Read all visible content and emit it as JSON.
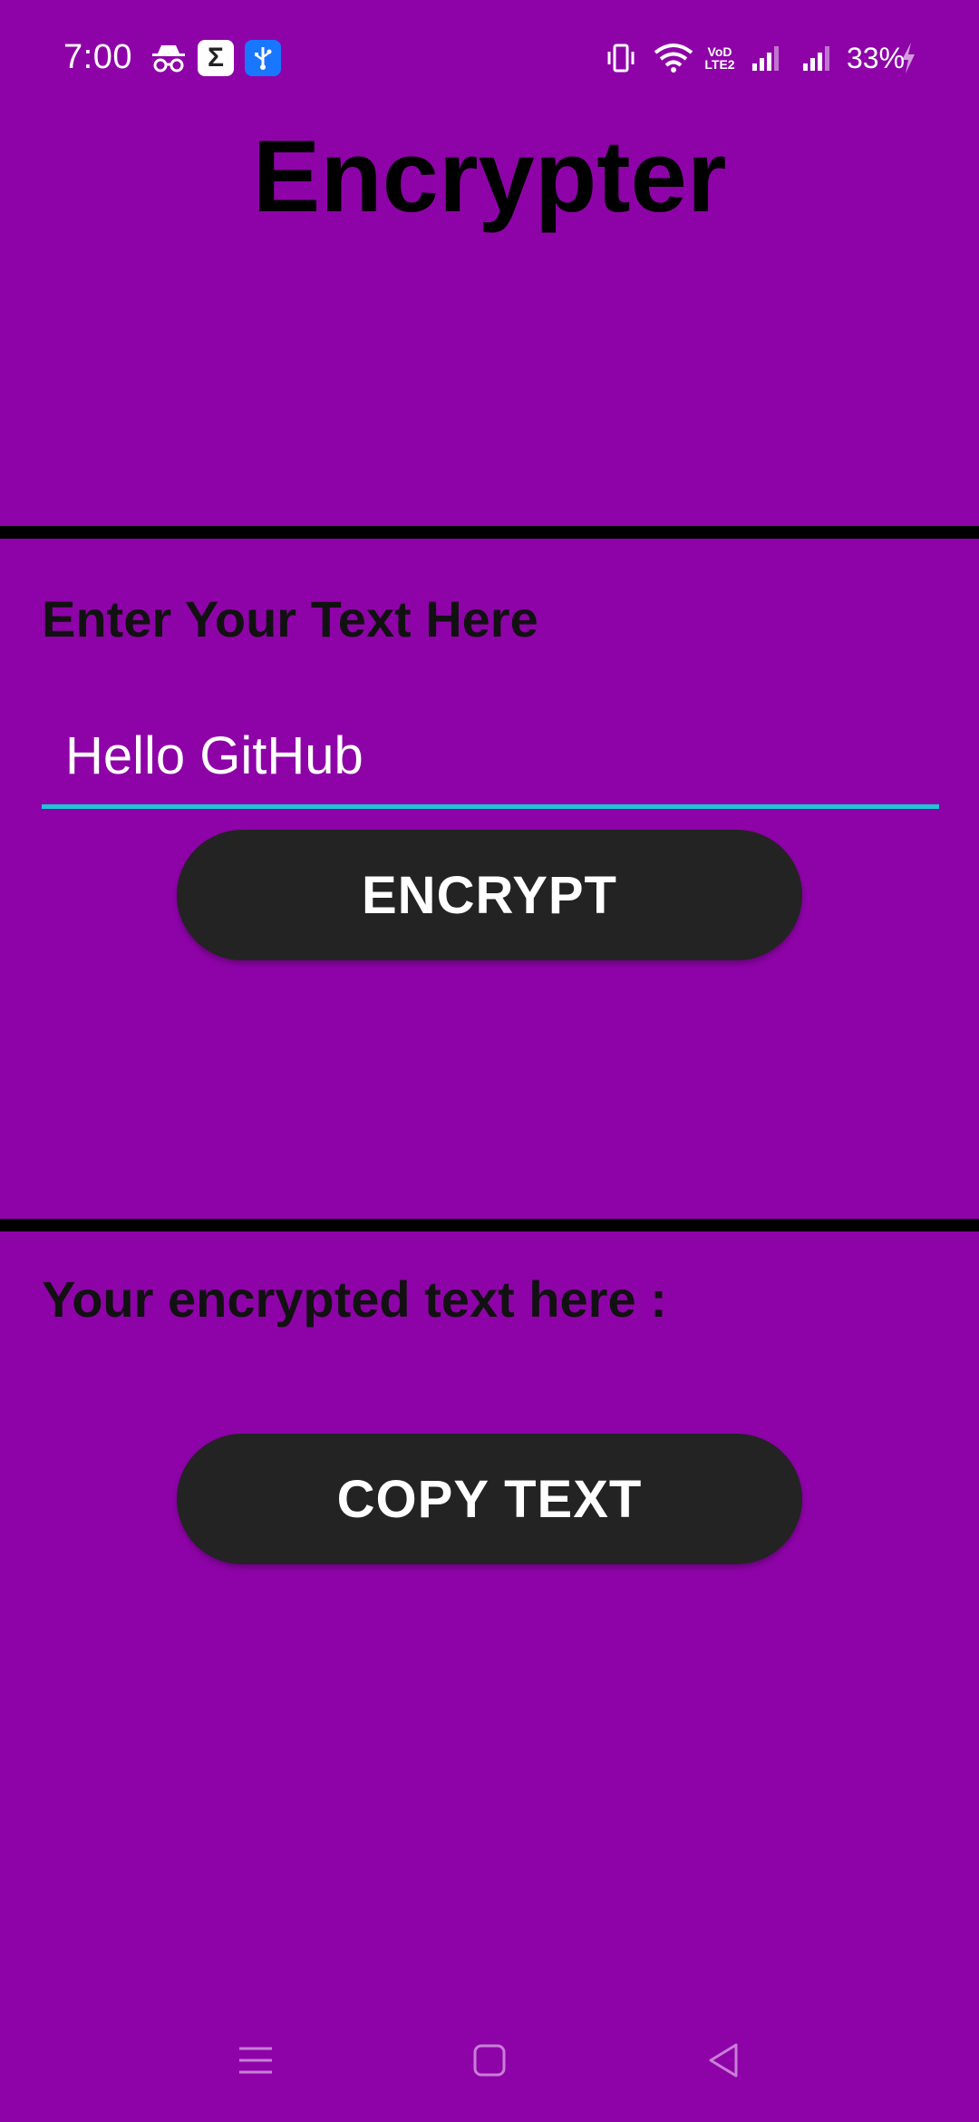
{
  "status_bar": {
    "time": "7:00",
    "battery": "33%",
    "volte_top": "VoD",
    "volte_bottom": "LTE2",
    "icons": [
      "incognito-icon",
      "sigma-icon",
      "usb-icon",
      "vibrate-icon",
      "wifi-icon",
      "volte-icon",
      "signal-icon",
      "signal-icon",
      "charging-icon"
    ]
  },
  "app": {
    "title": "Encrypter",
    "input_label": "Enter Your Text Here",
    "input_value": "Hello GitHub",
    "encrypt_button": "ENCRYPT",
    "output_label": "Your encrypted text here :",
    "output_value": "",
    "copy_button": "COPY TEXT"
  },
  "nav_bar": {
    "icons": [
      "menu-icon",
      "home-icon",
      "back-icon"
    ]
  },
  "colors": {
    "background": "#8e03a8",
    "button": "#232323",
    "input_underline": "#1ec6d4",
    "divider": "#000000"
  }
}
